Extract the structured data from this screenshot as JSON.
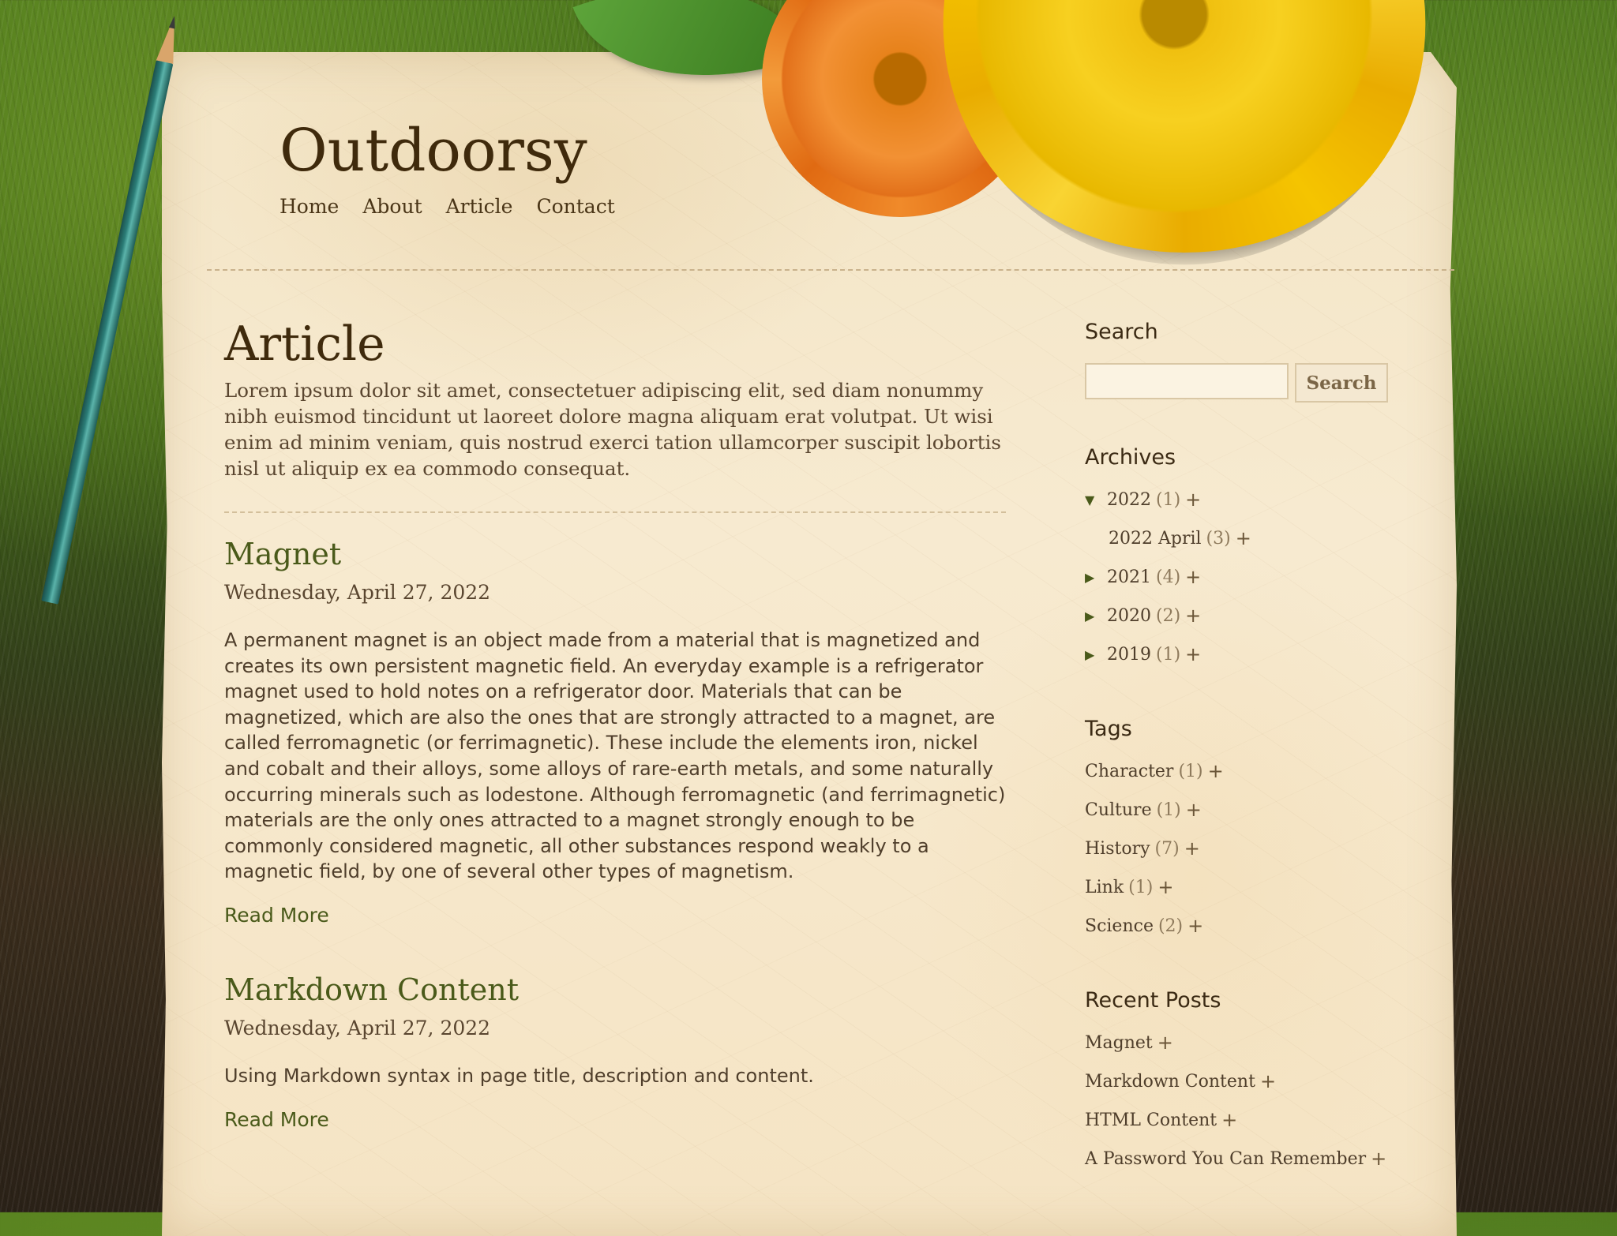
{
  "site": {
    "title": "Outdoorsy",
    "nav": [
      "Home",
      "About",
      "Article",
      "Contact"
    ]
  },
  "page": {
    "title": "Article",
    "intro": "Lorem ipsum dolor sit amet, consectetuer adipiscing elit, sed diam nonummy nibh euismod tincidunt ut laoreet dolore magna aliquam erat volutpat. Ut wisi enim ad minim veniam, quis nostrud exerci tation ullamcorper suscipit lobortis nisl ut aliquip ex ea commodo consequat."
  },
  "posts": [
    {
      "title": "Magnet",
      "date": "Wednesday, April 27, 2022",
      "excerpt": "A permanent magnet is an object made from a material that is magnetized and creates its own persistent magnetic field. An everyday example is a refrigerator magnet used to hold notes on a refrigerator door. Materials that can be magnetized, which are also the ones that are strongly attracted to a magnet, are called ferromagnetic (or ferrimagnetic). These include the elements iron, nickel and cobalt and their alloys, some alloys of rare-earth metals, and some naturally occurring minerals such as lodestone. Although ferromagnetic (and ferrimagnetic) materials are the only ones attracted to a magnet strongly enough to be commonly considered magnetic, all other substances respond weakly to a magnetic field, by one of several other types of magnetism.",
      "read_more": "Read More"
    },
    {
      "title": "Markdown Content",
      "date": "Wednesday, April 27, 2022",
      "excerpt": "Using Markdown syntax in page title, description and content.",
      "read_more": "Read More"
    }
  ],
  "sidebar": {
    "search": {
      "title": "Search",
      "placeholder": "",
      "button": "Search"
    },
    "archives": {
      "title": "Archives",
      "items": [
        {
          "label": "2022",
          "count": "(1)",
          "plus": "+",
          "toggle": "▼"
        },
        {
          "label": "2022 April",
          "count": "(3)",
          "plus": "+",
          "toggle": ""
        },
        {
          "label": "2021",
          "count": "(4)",
          "plus": "+",
          "toggle": "▶"
        },
        {
          "label": "2020",
          "count": "(2)",
          "plus": "+",
          "toggle": "▶"
        },
        {
          "label": "2019",
          "count": "(1)",
          "plus": "+",
          "toggle": "▶"
        }
      ]
    },
    "tags": {
      "title": "Tags",
      "items": [
        {
          "label": "Character",
          "count": "(1)",
          "plus": "+"
        },
        {
          "label": "Culture",
          "count": "(1)",
          "plus": "+"
        },
        {
          "label": "History",
          "count": "(7)",
          "plus": "+"
        },
        {
          "label": "Link",
          "count": "(1)",
          "plus": "+"
        },
        {
          "label": "Science",
          "count": "(2)",
          "plus": "+"
        }
      ]
    },
    "recent": {
      "title": "Recent Posts",
      "items": [
        {
          "label": "Magnet",
          "plus": "+"
        },
        {
          "label": "Markdown Content",
          "plus": "+"
        },
        {
          "label": "HTML Content",
          "plus": "+"
        },
        {
          "label": "A Password You Can Remember",
          "plus": "+"
        }
      ]
    }
  },
  "colors": {
    "accent_green": "#4a5a1a",
    "title_brown": "#3f2a0c",
    "paper": "#f5e6c8"
  },
  "icons": {
    "expanded": "triangle-down-icon",
    "collapsed": "triangle-right-icon",
    "add": "plus-icon"
  }
}
